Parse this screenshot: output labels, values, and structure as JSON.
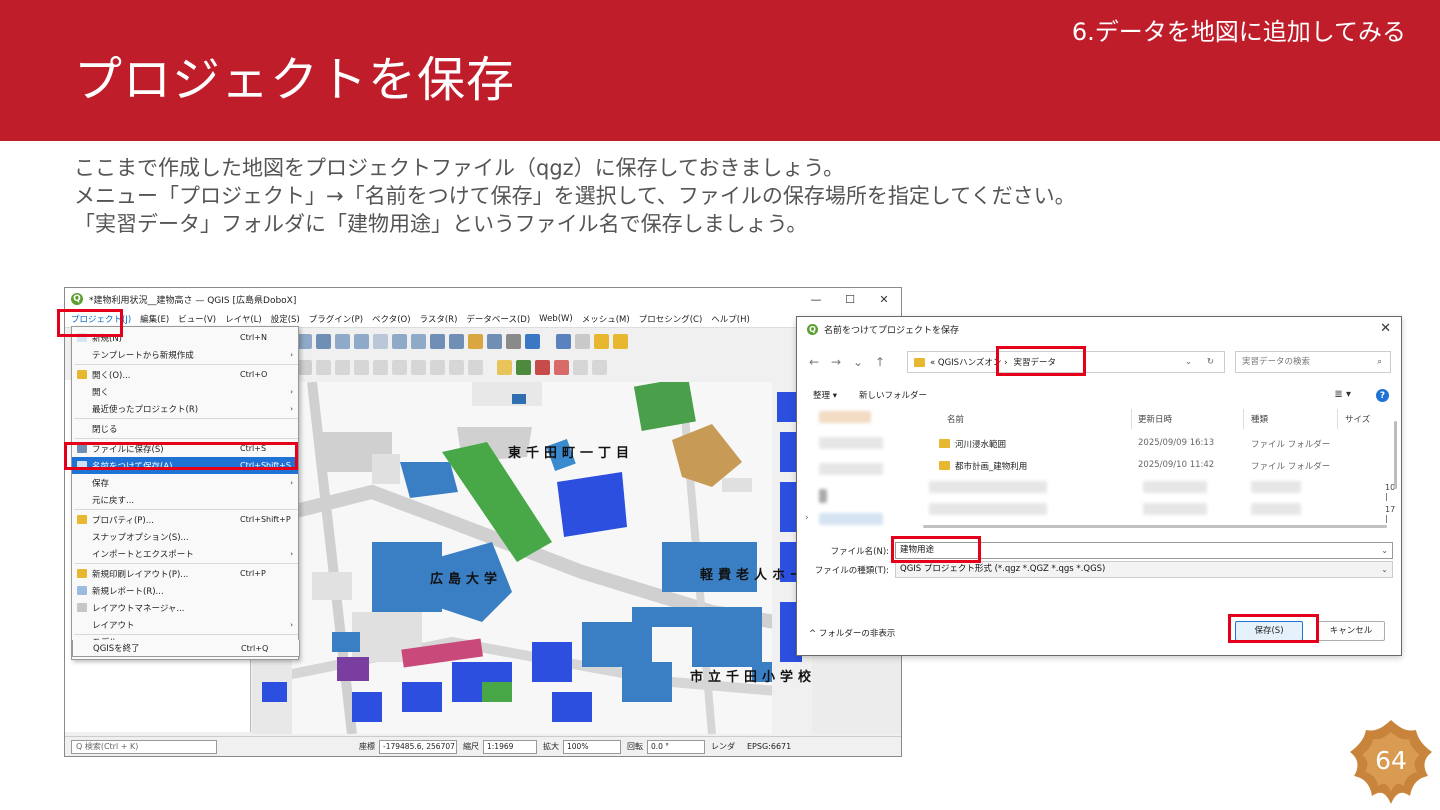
{
  "slide": {
    "title": "プロジェクトを保存",
    "section": "6.データを地図に追加してみる",
    "body": [
      "ここまで作成した地図をプロジェクトファイル（qgz）に保存しておきましょう。",
      "メニュー「プロジェクト」→「名前をつけて保存」を選択して、ファイルの保存場所を指定してください。",
      "「実習データ」フォルダに「建物用途」というファイル名で保存しましょう。"
    ],
    "page_number": "64"
  },
  "colors": {
    "header": "#c01d2b",
    "highlight": "#e4001b",
    "menu_highlight": "#1e73d4",
    "badge": "#c8843a"
  },
  "qgis": {
    "title": "*建物利用状況__建物高さ — QGIS [広島県DoboX]",
    "win_minimize": "—",
    "win_maximize": "☐",
    "win_close": "✕",
    "menubar": [
      "プロジェクト(J)",
      "編集(E)",
      "ビュー(V)",
      "レイヤ(L)",
      "設定(S)",
      "プラグイン(P)",
      "ベクタ(O)",
      "ラスタ(R)",
      "データベース(D)",
      "Web(W)",
      "メッシュ(M)",
      "プロセシング(C)",
      "ヘルプ(H)"
    ],
    "project_menu": [
      {
        "label": "新規(N)",
        "shortcut": "Ctrl+N",
        "arrow": ""
      },
      {
        "label": "テンプレートから新規作成",
        "shortcut": "",
        "arrow": "›"
      },
      {
        "label": "開く(O)...",
        "shortcut": "Ctrl+O",
        "arrow": ""
      },
      {
        "label": "開く",
        "shortcut": "",
        "arrow": "›"
      },
      {
        "label": "最近使ったプロジェクト(R)",
        "shortcut": "",
        "arrow": "›"
      },
      {
        "label": "閉じる",
        "shortcut": "",
        "arrow": ""
      },
      {
        "label": "ファイルに保存(S)",
        "shortcut": "Ctrl+S",
        "arrow": ""
      },
      {
        "label": "名前をつけて保存(A)...",
        "shortcut": "Ctrl+Shift+S",
        "arrow": ""
      },
      {
        "label": "保存",
        "shortcut": "",
        "arrow": "›"
      },
      {
        "label": "元に戻す...",
        "shortcut": "",
        "arrow": ""
      },
      {
        "label": "プロパティ(P)...",
        "shortcut": "Ctrl+Shift+P",
        "arrow": ""
      },
      {
        "label": "スナップオプション(S)...",
        "shortcut": "",
        "arrow": ""
      },
      {
        "label": "インポートとエクスポート",
        "shortcut": "",
        "arrow": "›"
      },
      {
        "label": "新規印刷レイアウト(P)...",
        "shortcut": "Ctrl+P",
        "arrow": ""
      },
      {
        "label": "新規レポート(R)...",
        "shortcut": "",
        "arrow": ""
      },
      {
        "label": "レイアウトマネージャ...",
        "shortcut": "",
        "arrow": ""
      },
      {
        "label": "レイアウト",
        "shortcut": "",
        "arrow": "›"
      },
      {
        "label": "モデル",
        "shortcut": "",
        "arrow": "›"
      },
      {
        "label": "QGISを終了",
        "shortcut": "Ctrl+Q",
        "arrow": ""
      }
    ],
    "map_labels": {
      "label1": "東千田町一丁目",
      "label2": "広島大学",
      "label3": "軽費老人ホーム",
      "label4": "市立千田小学校"
    },
    "status": {
      "search_placeholder": "Q 検索(Ctrl + K)",
      "coord_label": "座標",
      "coord_value": "-179485.6, 256707",
      "scale_label": "縮尺",
      "scale_value": "1:1969",
      "magnify_label": "拡大",
      "magnify_value": "100%",
      "rotation_label": "回転",
      "rotation_value": "0.0 °",
      "render_label": "レンダ",
      "crs": "EPSG:6671"
    }
  },
  "dialog": {
    "title": "名前をつけてプロジェクトを保存",
    "close": "✕",
    "nav": [
      "←",
      "→",
      "⌄",
      "↑"
    ],
    "address_prefix": "« QGISハンズオン ›",
    "address_current": "実習データ",
    "address_dropdown": "⌄",
    "address_refresh": "↻",
    "search_placeholder": "実習データの検索",
    "search_icon": "⌕",
    "organize": "整理 ▾",
    "new_folder": "新しいフォルダー",
    "view_icon": "≣ ▾",
    "help_icon": "?",
    "columns": [
      "名前",
      "更新日時",
      "種類",
      "サイズ"
    ],
    "rows": [
      {
        "name": "河川浸水範囲",
        "date": "2025/09/09 16:13",
        "type": "ファイル フォルダー"
      },
      {
        "name": "都市計画_建物利用",
        "date": "2025/09/10 11:42",
        "type": "ファイル フォルダー"
      }
    ],
    "size_partial": [
      "10 |",
      "17 |"
    ],
    "filename_label": "ファイル名(N):",
    "filename_value": "建物用途",
    "filetype_label": "ファイルの種類(T):",
    "filetype_value": "QGIS プロジェクト形式 (*.qgz *.QGZ *.qgs *.QGS)",
    "hide_folders": "^ フォルダーの非表示",
    "save_button": "保存(S)",
    "cancel_button": "キャンセル"
  }
}
